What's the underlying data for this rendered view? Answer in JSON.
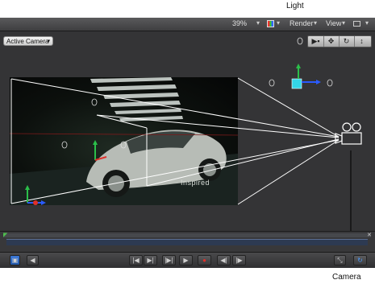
{
  "topbar": {
    "zoom": "39%",
    "render_label": "Render",
    "view_label": "View"
  },
  "canvas": {
    "camera_menu": "Active Camera",
    "render_text": "Inspired"
  },
  "callouts": {
    "light": "Light",
    "camera": "Camera"
  },
  "colors": {
    "app_bg": "#2c2c2e",
    "accent": "#2a7de1",
    "light_cyan": "#33d6e8",
    "axis_green": "#2bbf4a",
    "axis_blue": "#2a5bff",
    "axis_red": "#e0302a"
  }
}
